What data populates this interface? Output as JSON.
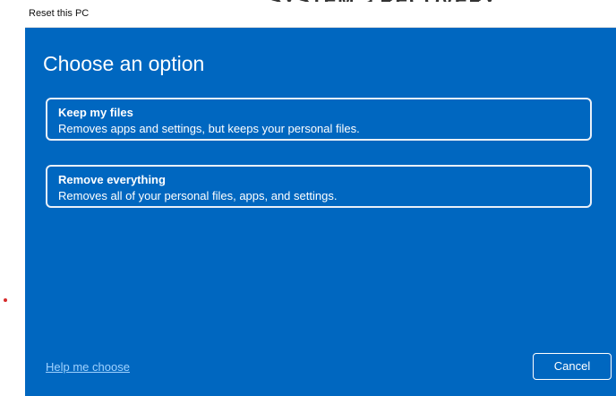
{
  "window": {
    "title": "Reset this PC"
  },
  "dialog": {
    "heading": "Choose an option",
    "options": [
      {
        "title": "Keep my files",
        "description": "Removes apps and settings, but keeps your personal files."
      },
      {
        "title": "Remove everything",
        "description": "Removes all of your personal files, apps, and settings."
      }
    ],
    "help_link": "Help me choose",
    "cancel_label": "Cancel"
  },
  "colors": {
    "background": "#0067c0",
    "text": "#ffffff",
    "link": "#9fd2ff",
    "titlebar": "#ffffff"
  }
}
